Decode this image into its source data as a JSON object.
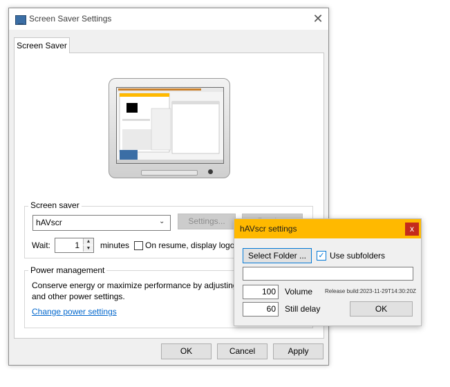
{
  "window": {
    "title": "Screen Saver Settings",
    "close_glyph": "✕"
  },
  "tabs": [
    {
      "label": "Screen Saver"
    }
  ],
  "screen_saver_group": {
    "label": "Screen saver",
    "selected": "hAVscr",
    "settings_label": "Settings...",
    "preview_label": "Preview",
    "wait_label": "Wait:",
    "wait_value": "1",
    "minutes_label": "minutes",
    "resume_label": "On resume, display logon screen",
    "resume_checked": false
  },
  "power_group": {
    "label": "Power management",
    "description": "Conserve energy or maximize performance by adjusting display brightness and other power settings.",
    "link": "Change power settings"
  },
  "footer": {
    "ok": "OK",
    "cancel": "Cancel",
    "apply": "Apply"
  },
  "popup": {
    "title": "hAVscr settings",
    "close_glyph": "x",
    "select_folder": "Select Folder ...",
    "use_subfolders": "Use subfolders",
    "use_subfolders_checked": true,
    "check_glyph": "✓",
    "folder_path": "",
    "volume_value": "100",
    "volume_label": "Volume",
    "release": "Release build:2023-11-29T14:30:20Z",
    "still_delay_value": "60",
    "still_delay_label": "Still delay",
    "ok": "OK"
  },
  "icons": {
    "monitor": "monitor-icon",
    "spin_up": "▲",
    "spin_down": "▼",
    "dropdown": "⌄"
  },
  "colors": {
    "popup_title": "#ffb900",
    "close_red": "#c42b1c",
    "link": "#0066cc",
    "accent": "#0078d7"
  }
}
